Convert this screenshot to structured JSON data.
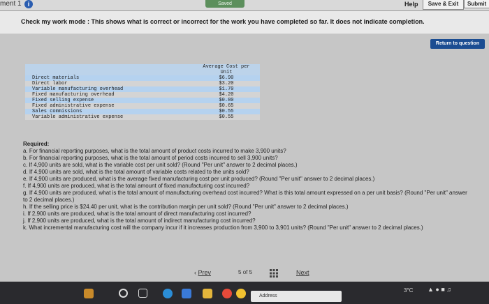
{
  "topbar": {
    "assignment_label": "ment 1",
    "info_glyph": "i",
    "saved_label": "Saved",
    "help_label": "Help",
    "save_exit_label": "Save & Exit",
    "submit_label": "Submit"
  },
  "banner": {
    "text": "Check my work mode : This shows what is correct or incorrect for the work you have completed so far. It does not indicate completion."
  },
  "return_button": {
    "label": "Return to question"
  },
  "cost_table": {
    "header_line1": "Average Cost per",
    "header_line2": "Unit",
    "rows": [
      {
        "label": "Direct materials",
        "value": "$6.90"
      },
      {
        "label": "Direct labor",
        "value": "$3.20"
      },
      {
        "label": "Variable manufacturing overhead",
        "value": "$1.70"
      },
      {
        "label": "Fixed manufacturing overhead",
        "value": "$4.20"
      },
      {
        "label": "Fixed selling expense",
        "value": "$0.80"
      },
      {
        "label": "Fixed administrative expense",
        "value": "$0.65"
      },
      {
        "label": "Sales commissions",
        "value": "$0.55"
      },
      {
        "label": "Variable administrative expense",
        "value": "$0.55"
      }
    ]
  },
  "questions": {
    "required_label": "Required:",
    "items": [
      "a. For financial reporting purposes, what is the total amount of product costs incurred to make 3,900 units?",
      "b. For financial reporting purposes, what is the total amount of period costs incurred to sell 3,900 units?",
      "c. If 4,900 units are sold, what is the variable cost per unit sold? (Round \"Per unit\" answer to 2 decimal places.)",
      "d. If 4,900 units are sold, what is the total amount of variable costs related to the units sold?",
      "e. If 4,900 units are produced, what is the average fixed manufacturing cost per unit produced? (Round \"Per unit\" answer to 2 decimal places.)",
      "f. If 4,900 units are produced, what is the total amount of fixed manufacturing cost incurred?",
      "g. If 4,900 units are produced, what is the total amount of manufacturing overhead cost incurred? What is this total amount expressed on a per unit basis? (Round \"Per unit\" answer to 2 decimal places.)",
      "h. If the selling price is $24.40 per unit, what is the contribution margin per unit sold? (Round \"Per unit\" answer to 2 decimal places.)",
      "i. If 2,900 units are produced, what is the total amount of direct manufacturing cost incurred?",
      "j. If 2,900 units are produced, what is the total amount of indirect manufacturing cost incurred?",
      "k. What incremental manufacturing cost will the company incur if it increases production from 3,900 to 3,901 units? (Round \"Per unit\" answer to 2 decimal places.)"
    ]
  },
  "pager": {
    "prev_label": "Prev",
    "page_current": "5",
    "page_of": "of",
    "page_total": "5",
    "next_label": "Next"
  },
  "taskbar": {
    "address_label": "Address",
    "temperature": "3°C"
  }
}
